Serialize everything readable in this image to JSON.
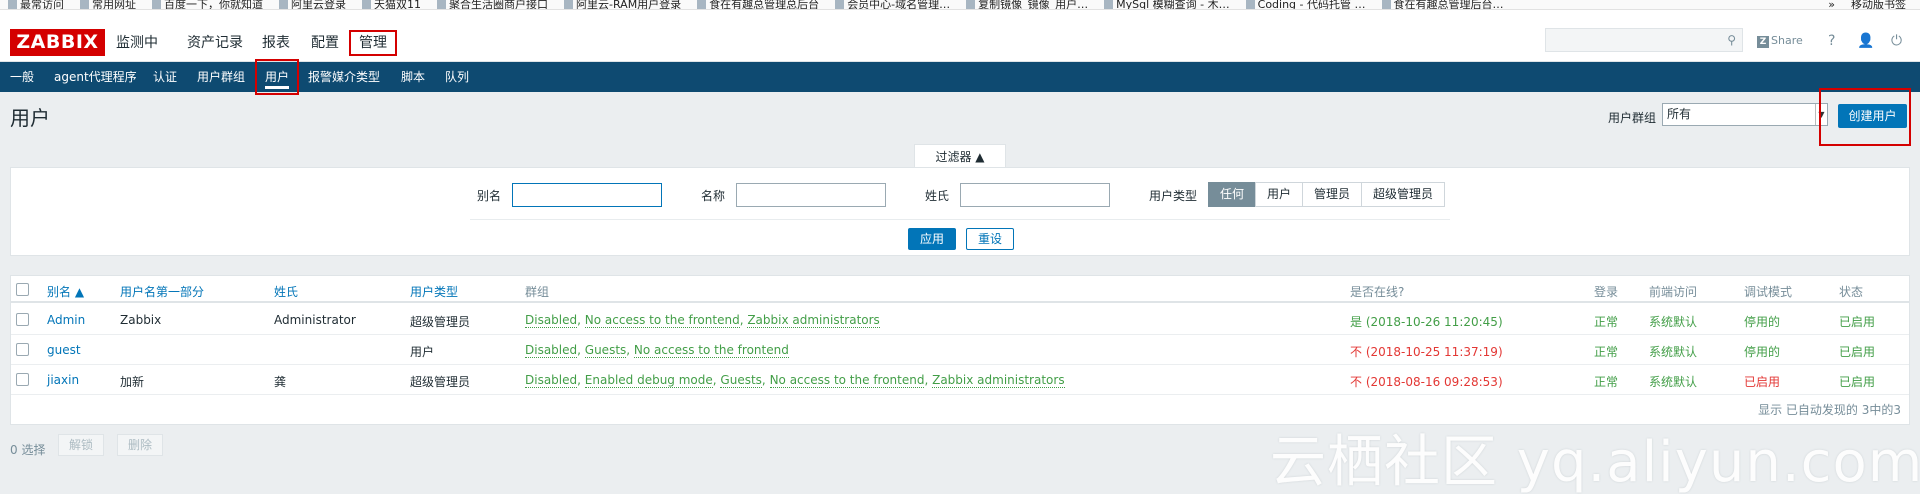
{
  "bookmarks": [
    "最常访问",
    "常用网址",
    "百度一下，你就知道",
    "阿里云登录",
    "天猫双11",
    "聚合生活圈商户接口",
    "阿里云-RAM用户登录",
    "食在有趣总管理总后台",
    "会员中心-域名管理…",
    "复制镜像_镜像_用户…",
    "MySql 模糊查询 - 木…",
    "Coding - 代码托管 …",
    "食在有趣总管理后台…"
  ],
  "bookmarks_more": "»",
  "bookmarks_mobile": "移动版书签",
  "header": {
    "logo": "ZABBIX",
    "menu": [
      "监测中",
      "资产记录",
      "报表",
      "配置",
      "管理"
    ],
    "active_menu": "管理",
    "search_value": "",
    "share_label": "Share",
    "help_icon": "?",
    "user_icon": "👤",
    "logout_icon": "⏻",
    "share_glyph": "Z"
  },
  "subnav": {
    "items": [
      "一般",
      "agent代理程序",
      "认证",
      "用户群组",
      "用户",
      "报警媒介类型",
      "脚本",
      "队列"
    ],
    "active": "用户"
  },
  "page": {
    "title": "用户",
    "group_label": "用户群组",
    "group_selected": "所有",
    "create_label": "创建用户"
  },
  "filter": {
    "tab_label": "过滤器 ▲",
    "alias_label": "别名",
    "alias_value": "",
    "name_label": "名称",
    "name_value": "",
    "surname_label": "姓氏",
    "surname_value": "",
    "type_label": "用户类型",
    "type_options": [
      "任何",
      "用户",
      "管理员",
      "超级管理员"
    ],
    "type_selected": "任何",
    "apply_label": "应用",
    "reset_label": "重设"
  },
  "table": {
    "columns": [
      "别名 ▲",
      "用户名第一部分",
      "姓氏",
      "用户类型",
      "群组",
      "是否在线?",
      "登录",
      "前端访问",
      "调试模式",
      "状态"
    ],
    "rows": [
      {
        "alias": "Admin",
        "name": "Zabbix",
        "surname": "Administrator",
        "type": "超级管理员",
        "groups": [
          "Disabled",
          "No access to the frontend",
          "Zabbix administrators"
        ],
        "online": "是 (2018-10-26 11:20:45)",
        "online_state": "yes",
        "login": "正常",
        "frontend": "系统默认",
        "debug": "停用的",
        "debug_state": "off",
        "status": "已启用"
      },
      {
        "alias": "guest",
        "name": "",
        "surname": "",
        "type": "用户",
        "groups": [
          "Disabled",
          "Guests",
          "No access to the frontend"
        ],
        "online": "不 (2018-10-25 11:37:19)",
        "online_state": "no",
        "login": "正常",
        "frontend": "系统默认",
        "debug": "停用的",
        "debug_state": "off",
        "status": "已启用"
      },
      {
        "alias": "jiaxin",
        "name": "加新",
        "surname": "龚",
        "type": "超级管理员",
        "groups": [
          "Disabled",
          "Enabled debug mode",
          "Guests",
          "No access to the frontend",
          "Zabbix administrators"
        ],
        "online": "不 (2018-08-16 09:28:53)",
        "online_state": "no",
        "login": "正常",
        "frontend": "系统默认",
        "debug": "已启用",
        "debug_state": "on",
        "status": "已启用"
      }
    ],
    "footer": "显示 已自动发现的 3中的3"
  },
  "bottom": {
    "selected": "0 选择",
    "unlock_label": "解锁",
    "delete_label": "删除"
  },
  "watermark": "云栖社区 yq.aliyun.com",
  "colors": {
    "brand": "#d40000",
    "nav": "#0e4a71",
    "link": "#0275b8",
    "ok": "#429e47",
    "bad": "#e33734",
    "muted": "#768d99"
  }
}
